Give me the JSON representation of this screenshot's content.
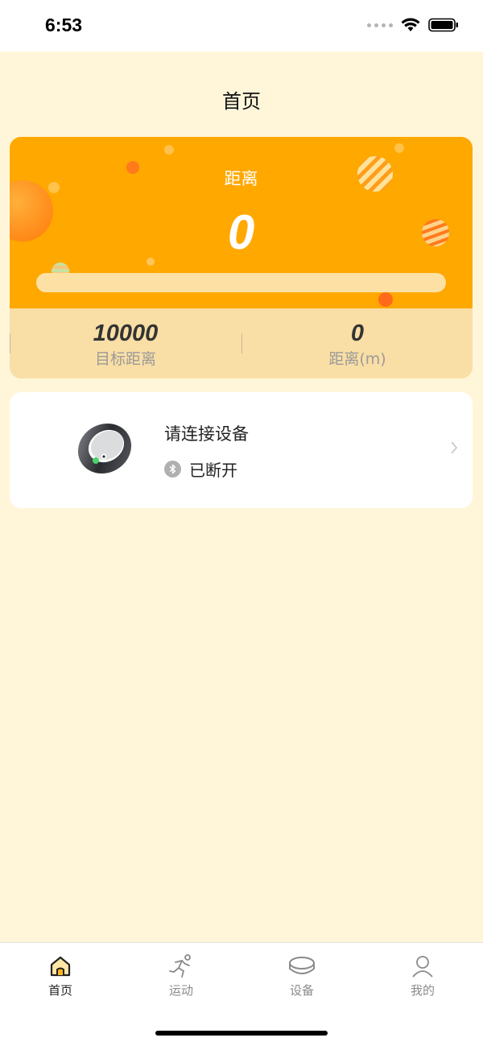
{
  "status_bar": {
    "time": "6:53"
  },
  "header": {
    "title": "首页"
  },
  "distance_card": {
    "label": "距离",
    "value": "0",
    "progress": 0,
    "stats": [
      {
        "value": "10000",
        "label": "目标距离"
      },
      {
        "value": "0",
        "label": "距离(m)"
      }
    ]
  },
  "device_card": {
    "title": "请连接设备",
    "status": "已断开"
  },
  "tab_bar": {
    "items": [
      {
        "label": "首页",
        "icon": "home-icon",
        "active": true
      },
      {
        "label": "运动",
        "icon": "runner-icon",
        "active": false
      },
      {
        "label": "设备",
        "icon": "ring-device-icon",
        "active": false
      },
      {
        "label": "我的",
        "icon": "user-icon",
        "active": false
      }
    ]
  },
  "colors": {
    "background": "#fff6d9",
    "card_orange": "#ffa800",
    "stats_band": "#f9dea5",
    "active_tab": "#222222",
    "inactive_tab": "#8a8a8a"
  }
}
